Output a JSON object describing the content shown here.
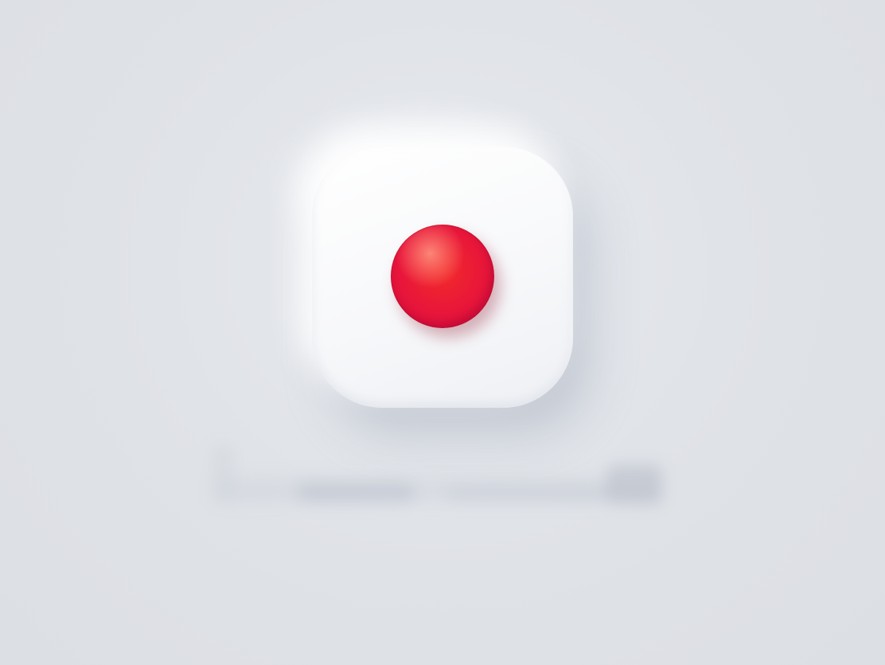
{
  "icon": {
    "name": "record-button",
    "tile_color": "#f6f7f9",
    "dot_color": "#ee1e34",
    "background_color": "#dfe2e7"
  }
}
